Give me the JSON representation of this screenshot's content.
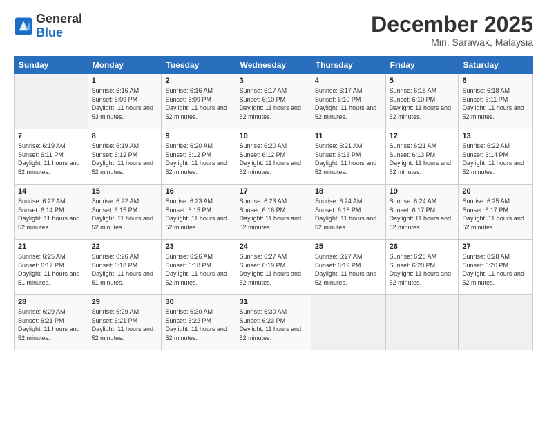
{
  "header": {
    "logo_general": "General",
    "logo_blue": "Blue",
    "month_title": "December 2025",
    "location": "Miri, Sarawak, Malaysia"
  },
  "days_of_week": [
    "Sunday",
    "Monday",
    "Tuesday",
    "Wednesday",
    "Thursday",
    "Friday",
    "Saturday"
  ],
  "weeks": [
    [
      {
        "day": "",
        "sunrise": "",
        "sunset": "",
        "daylight": ""
      },
      {
        "day": "1",
        "sunrise": "Sunrise: 6:16 AM",
        "sunset": "Sunset: 6:09 PM",
        "daylight": "Daylight: 11 hours and 53 minutes."
      },
      {
        "day": "2",
        "sunrise": "Sunrise: 6:16 AM",
        "sunset": "Sunset: 6:09 PM",
        "daylight": "Daylight: 11 hours and 52 minutes."
      },
      {
        "day": "3",
        "sunrise": "Sunrise: 6:17 AM",
        "sunset": "Sunset: 6:10 PM",
        "daylight": "Daylight: 11 hours and 52 minutes."
      },
      {
        "day": "4",
        "sunrise": "Sunrise: 6:17 AM",
        "sunset": "Sunset: 6:10 PM",
        "daylight": "Daylight: 11 hours and 52 minutes."
      },
      {
        "day": "5",
        "sunrise": "Sunrise: 6:18 AM",
        "sunset": "Sunset: 6:10 PM",
        "daylight": "Daylight: 11 hours and 52 minutes."
      },
      {
        "day": "6",
        "sunrise": "Sunrise: 6:18 AM",
        "sunset": "Sunset: 6:11 PM",
        "daylight": "Daylight: 11 hours and 52 minutes."
      }
    ],
    [
      {
        "day": "7",
        "sunrise": "Sunrise: 6:19 AM",
        "sunset": "Sunset: 6:11 PM",
        "daylight": "Daylight: 11 hours and 52 minutes."
      },
      {
        "day": "8",
        "sunrise": "Sunrise: 6:19 AM",
        "sunset": "Sunset: 6:12 PM",
        "daylight": "Daylight: 11 hours and 52 minutes."
      },
      {
        "day": "9",
        "sunrise": "Sunrise: 6:20 AM",
        "sunset": "Sunset: 6:12 PM",
        "daylight": "Daylight: 11 hours and 52 minutes."
      },
      {
        "day": "10",
        "sunrise": "Sunrise: 6:20 AM",
        "sunset": "Sunset: 6:12 PM",
        "daylight": "Daylight: 11 hours and 52 minutes."
      },
      {
        "day": "11",
        "sunrise": "Sunrise: 6:21 AM",
        "sunset": "Sunset: 6:13 PM",
        "daylight": "Daylight: 11 hours and 52 minutes."
      },
      {
        "day": "12",
        "sunrise": "Sunrise: 6:21 AM",
        "sunset": "Sunset: 6:13 PM",
        "daylight": "Daylight: 11 hours and 52 minutes."
      },
      {
        "day": "13",
        "sunrise": "Sunrise: 6:22 AM",
        "sunset": "Sunset: 6:14 PM",
        "daylight": "Daylight: 11 hours and 52 minutes."
      }
    ],
    [
      {
        "day": "14",
        "sunrise": "Sunrise: 6:22 AM",
        "sunset": "Sunset: 6:14 PM",
        "daylight": "Daylight: 11 hours and 52 minutes."
      },
      {
        "day": "15",
        "sunrise": "Sunrise: 6:22 AM",
        "sunset": "Sunset: 6:15 PM",
        "daylight": "Daylight: 11 hours and 52 minutes."
      },
      {
        "day": "16",
        "sunrise": "Sunrise: 6:23 AM",
        "sunset": "Sunset: 6:15 PM",
        "daylight": "Daylight: 11 hours and 52 minutes."
      },
      {
        "day": "17",
        "sunrise": "Sunrise: 6:23 AM",
        "sunset": "Sunset: 6:16 PM",
        "daylight": "Daylight: 11 hours and 52 minutes."
      },
      {
        "day": "18",
        "sunrise": "Sunrise: 6:24 AM",
        "sunset": "Sunset: 6:16 PM",
        "daylight": "Daylight: 11 hours and 52 minutes."
      },
      {
        "day": "19",
        "sunrise": "Sunrise: 6:24 AM",
        "sunset": "Sunset: 6:17 PM",
        "daylight": "Daylight: 11 hours and 52 minutes."
      },
      {
        "day": "20",
        "sunrise": "Sunrise: 6:25 AM",
        "sunset": "Sunset: 6:17 PM",
        "daylight": "Daylight: 11 hours and 52 minutes."
      }
    ],
    [
      {
        "day": "21",
        "sunrise": "Sunrise: 6:25 AM",
        "sunset": "Sunset: 6:17 PM",
        "daylight": "Daylight: 11 hours and 51 minutes."
      },
      {
        "day": "22",
        "sunrise": "Sunrise: 6:26 AM",
        "sunset": "Sunset: 6:18 PM",
        "daylight": "Daylight: 11 hours and 51 minutes."
      },
      {
        "day": "23",
        "sunrise": "Sunrise: 6:26 AM",
        "sunset": "Sunset: 6:18 PM",
        "daylight": "Daylight: 11 hours and 52 minutes."
      },
      {
        "day": "24",
        "sunrise": "Sunrise: 6:27 AM",
        "sunset": "Sunset: 6:19 PM",
        "daylight": "Daylight: 11 hours and 52 minutes."
      },
      {
        "day": "25",
        "sunrise": "Sunrise: 6:27 AM",
        "sunset": "Sunset: 6:19 PM",
        "daylight": "Daylight: 11 hours and 52 minutes."
      },
      {
        "day": "26",
        "sunrise": "Sunrise: 6:28 AM",
        "sunset": "Sunset: 6:20 PM",
        "daylight": "Daylight: 11 hours and 52 minutes."
      },
      {
        "day": "27",
        "sunrise": "Sunrise: 6:28 AM",
        "sunset": "Sunset: 6:20 PM",
        "daylight": "Daylight: 11 hours and 52 minutes."
      }
    ],
    [
      {
        "day": "28",
        "sunrise": "Sunrise: 6:29 AM",
        "sunset": "Sunset: 6:21 PM",
        "daylight": "Daylight: 11 hours and 52 minutes."
      },
      {
        "day": "29",
        "sunrise": "Sunrise: 6:29 AM",
        "sunset": "Sunset: 6:21 PM",
        "daylight": "Daylight: 11 hours and 52 minutes."
      },
      {
        "day": "30",
        "sunrise": "Sunrise: 6:30 AM",
        "sunset": "Sunset: 6:22 PM",
        "daylight": "Daylight: 11 hours and 52 minutes."
      },
      {
        "day": "31",
        "sunrise": "Sunrise: 6:30 AM",
        "sunset": "Sunset: 6:23 PM",
        "daylight": "Daylight: 11 hours and 52 minutes."
      },
      {
        "day": "",
        "sunrise": "",
        "sunset": "",
        "daylight": ""
      },
      {
        "day": "",
        "sunrise": "",
        "sunset": "",
        "daylight": ""
      },
      {
        "day": "",
        "sunrise": "",
        "sunset": "",
        "daylight": ""
      }
    ]
  ]
}
